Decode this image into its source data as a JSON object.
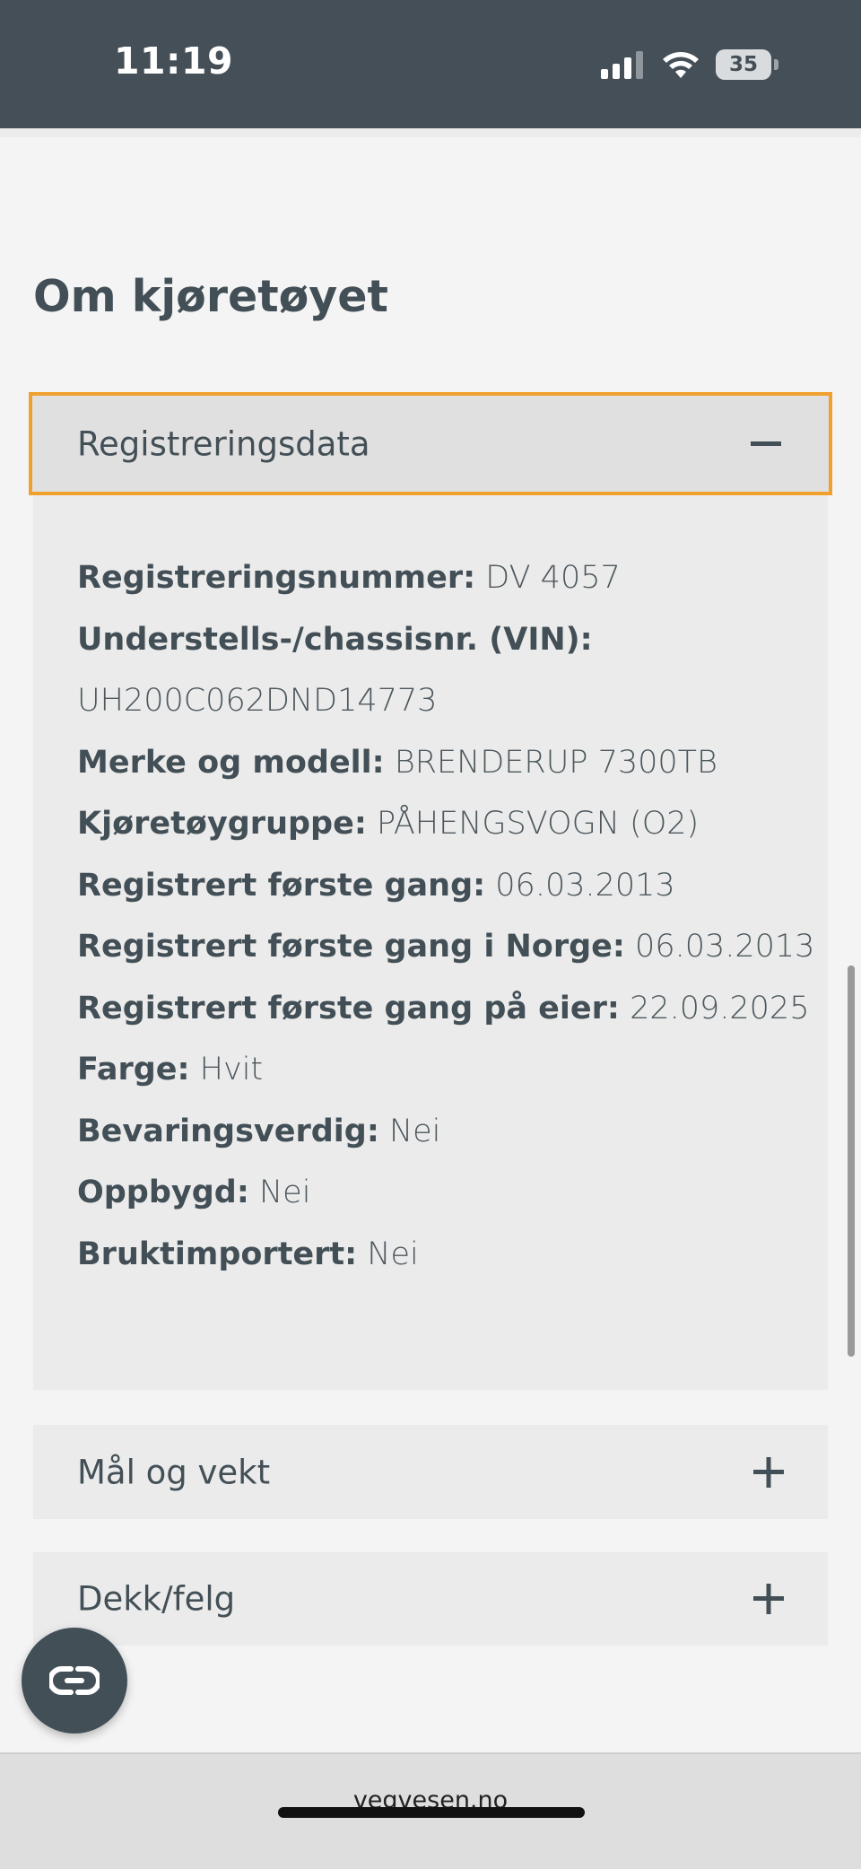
{
  "status_bar": {
    "time": "11:19",
    "battery": "35",
    "icons": [
      "signal-icon",
      "wifi-icon",
      "battery-icon"
    ]
  },
  "page": {
    "title": "Om kjøretøyet"
  },
  "sections": [
    {
      "title": "Registreringsdata",
      "expanded": true,
      "focused": true,
      "toggle_icon": "minus-icon",
      "details": [
        {
          "label": "Registreringsnummer:",
          "value": "DV 4057"
        },
        {
          "label": "Understells-/chassisnr. (VIN):",
          "value": ""
        },
        {
          "label": "",
          "value": "UH200C062DND14773"
        },
        {
          "label": "Merke og modell:",
          "value": "BRENDERUP 7300TB"
        },
        {
          "label": "Kjøretøygruppe:",
          "value": "PÅHENGSVOGN (O2)"
        },
        {
          "label": "Registrert første gang:",
          "value": "06.03.2013"
        },
        {
          "label": "Registrert første gang i Norge:",
          "value": "06.03.2013"
        },
        {
          "label": "Registrert første gang på eier:",
          "value": "22.09.2025"
        },
        {
          "label": "Farge:",
          "value": "Hvit"
        },
        {
          "label": "Bevaringsverdig:",
          "value": "Nei"
        },
        {
          "label": "Oppbygd:",
          "value": "Nei"
        },
        {
          "label": "Bruktimportert:",
          "value": "Nei"
        }
      ]
    },
    {
      "title": "Mål og vekt",
      "expanded": false,
      "toggle_icon": "plus-icon"
    },
    {
      "title": "Dekk/felg",
      "expanded": false,
      "toggle_icon": "plus-icon"
    }
  ],
  "fab": {
    "icon": "link-icon"
  },
  "browser": {
    "url": "vegvesen.no"
  },
  "colors": {
    "status_bar": "#444f57",
    "focus_ring": "#f0a02d",
    "accordion_bg": "#ebebeb",
    "text": "#434f56"
  }
}
